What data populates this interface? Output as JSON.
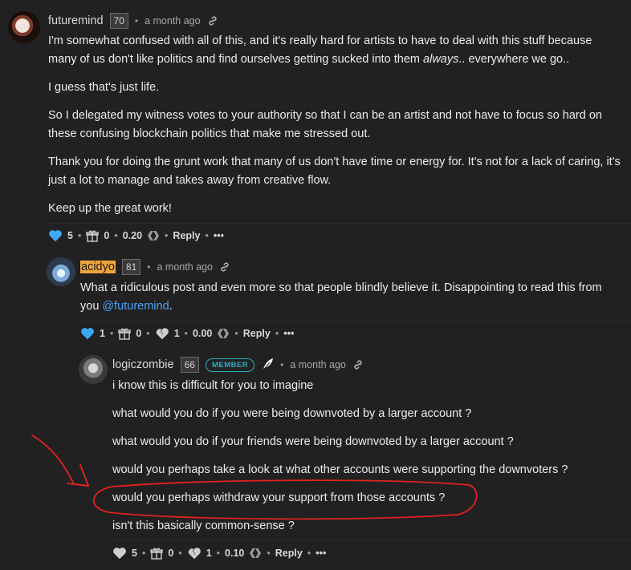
{
  "comments": [
    {
      "author": "futuremind",
      "reputation": "70",
      "time": "a month ago",
      "paragraphs": {
        "p1_a": "I'm somewhat confused with all of this, and it's really hard for artists to have to deal with this stuff because many of us don't like politics and find ourselves getting sucked into them ",
        "p1_em": "always",
        "p1_b": ".. everywhere we go..",
        "p2": "I guess that's just life.",
        "p3": "So I delegated my witness votes to your authority so that I can be an artist and not have to focus so hard on these confusing blockchain politics that make me stressed out.",
        "p4": "Thank you for doing the grunt work that many of us don't have time or energy for. It's not for a lack of caring, it's just a lot to manage and takes away from creative flow.",
        "p5": "Keep up the great work!"
      },
      "actions": {
        "likes": "5",
        "gifts": "0",
        "payout": "0.20",
        "reply": "Reply",
        "more": "•••"
      }
    },
    {
      "author": "acidyo",
      "reputation": "81",
      "time": "a month ago",
      "text_a": "What a ridiculous post and even more so that people blindly believe it. Disappointing to read this from you ",
      "mention": "@futuremind",
      "text_b": ".",
      "actions": {
        "likes": "1",
        "gifts": "0",
        "downvotes": "1",
        "payout": "0.00",
        "reply": "Reply",
        "more": "•••"
      }
    },
    {
      "author": "logiczombie",
      "reputation": "66",
      "badge": "MEMBER",
      "time": "a month ago",
      "lines": [
        "i know this is difficult for you to imagine",
        "what would you do if you were being downvoted by a larger account ?",
        "what would you do if your friends were being downvoted by a larger account ?",
        "would you perhaps take a look at what other accounts were supporting the downvoters ?",
        "would you perhaps withdraw your support from those accounts ?",
        "isn't this basically common-sense ?"
      ],
      "actions": {
        "likes": "5",
        "gifts": "0",
        "downvotes": "1",
        "payout": "0.10",
        "reply": "Reply",
        "more": "•••"
      }
    }
  ],
  "colors": {
    "background": "#212121",
    "heart_active": "#3ea8f4",
    "heart_inactive": "#cfcfcf",
    "mention": "#4ea0f5",
    "member_badge": "#2bb0c4",
    "annotation": "#e0231f",
    "highlight": "#f0a53c"
  },
  "icons": [
    "link-icon",
    "heart-icon",
    "gift-icon",
    "broken-heart-icon",
    "hive-icon",
    "feather-icon"
  ]
}
